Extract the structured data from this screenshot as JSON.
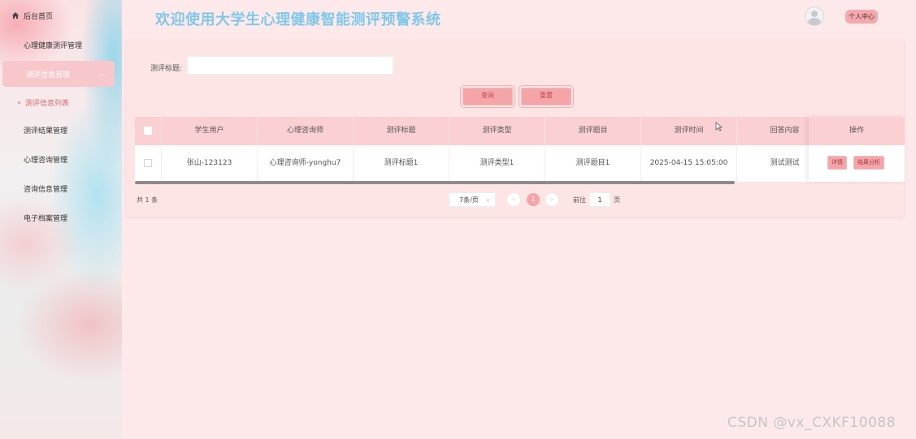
{
  "sidebar": {
    "items": [
      {
        "label": "后台首页",
        "icon": "home-icon"
      },
      {
        "label": "心理健康测评管理",
        "icon": "grid-icon"
      },
      {
        "label": "测评信息管理",
        "icon": "grid-icon",
        "active": true
      },
      {
        "label": "测评结果管理",
        "icon": "grid-icon"
      },
      {
        "label": "心理咨询管理",
        "icon": "grid-icon"
      },
      {
        "label": "咨询信息管理",
        "icon": "grid-icon"
      },
      {
        "label": "电子档案管理",
        "icon": "grid-icon"
      }
    ],
    "sub_item": "测评信息列表"
  },
  "header": {
    "title": "欢迎使用大学生心理健康智能测评预警系统",
    "profile_button": "个人中心"
  },
  "search": {
    "label": "测评标题:",
    "value": "",
    "query_button": "查询",
    "reset_button": "重置"
  },
  "table": {
    "columns": [
      "学生用户",
      "心理咨询师",
      "测评标题",
      "测评类型",
      "测评题目",
      "测评时间",
      "回答内容",
      "操作"
    ],
    "rows": [
      {
        "student": "张山-123123",
        "counselor": "心理咨询师-yonghu7",
        "title": "测评标题1",
        "type": "测评类型1",
        "question": "测评题目1",
        "time": "2025-04-15 15:05:00",
        "answer": "测试测试",
        "actions": [
          "详情",
          "结果分析"
        ]
      }
    ]
  },
  "pagination": {
    "total": "共 1 条",
    "page_size": "7条/页",
    "current_page": "1",
    "goto_label": "前往",
    "goto_value": "1",
    "goto_unit": "页"
  },
  "watermark": "CSDN @vx_CXKF10088",
  "colors": {
    "accent": "#f5a4a8",
    "title": "#7fc8ec",
    "background": "#fde9ea"
  }
}
